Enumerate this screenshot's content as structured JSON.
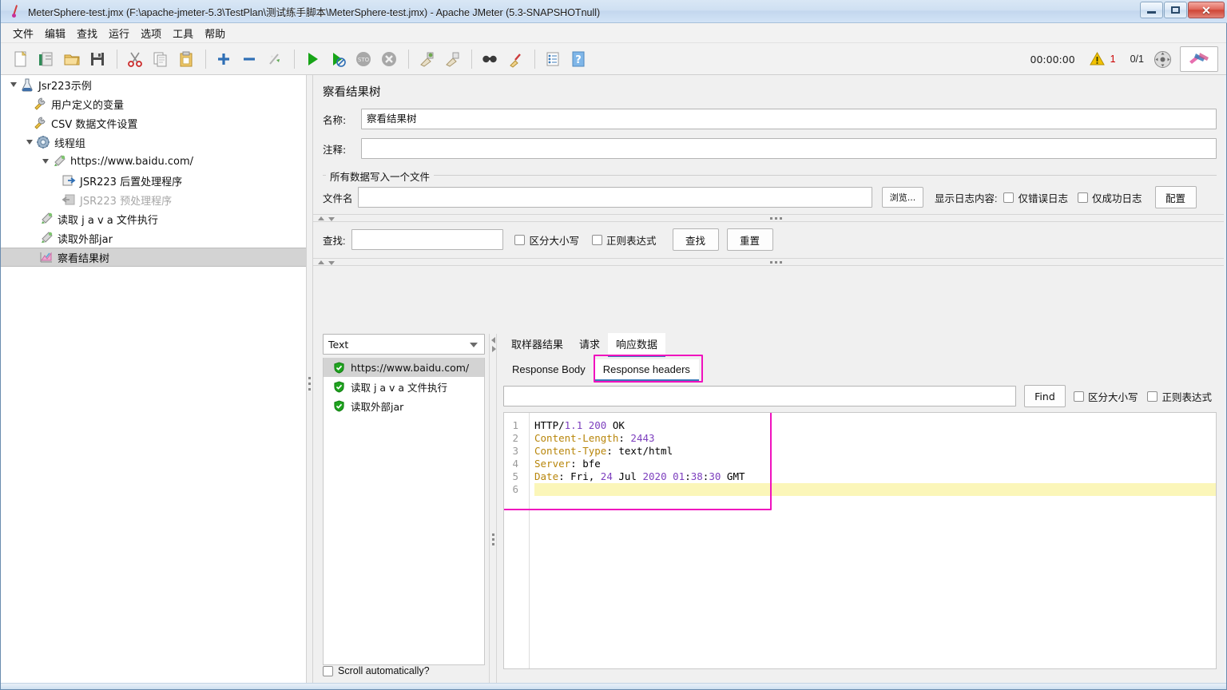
{
  "window": {
    "title": "MeterSphere-test.jmx (F:\\apache-jmeter-5.3\\TestPlan\\测试练手脚本\\MeterSphere-test.jmx) - Apache JMeter (5.3-SNAPSHOTnull)",
    "minimize_label": "–",
    "maximize_label": "❐",
    "close_label": "✕"
  },
  "menu": {
    "items": [
      {
        "label": "文件",
        "name": "menu-file"
      },
      {
        "label": "编辑",
        "name": "menu-edit"
      },
      {
        "label": "查找",
        "name": "menu-search"
      },
      {
        "label": "运行",
        "name": "menu-run"
      },
      {
        "label": "选项",
        "name": "menu-options"
      },
      {
        "label": "工具",
        "name": "menu-tools"
      },
      {
        "label": "帮助",
        "name": "menu-help"
      }
    ]
  },
  "toolbar": {
    "icons": [
      "new-icon",
      "templates-icon",
      "open-icon",
      "save-icon",
      "cut-icon",
      "copy-icon",
      "paste-icon",
      "expand-icon",
      "collapse-icon",
      "toggle-icon",
      "start-icon",
      "start-no-timers-icon",
      "stop-icon",
      "shutdown-icon",
      "clear-icon",
      "clear-all-icon",
      "search-icon",
      "search-reset-icon",
      "function-helper-icon",
      "help-icon"
    ],
    "elapsed_time": "00:00:00",
    "warning_count": "1",
    "thread_counts": "0/1",
    "logo_name": "jmeter-logo-button"
  },
  "tree": {
    "nodes": [
      {
        "label": "Jsr223示例",
        "icon": "test-plan-icon",
        "indent": 0,
        "expanded": true,
        "disabled": false,
        "selected": false
      },
      {
        "label": "用户定义的变量",
        "icon": "config-element-icon",
        "indent": 1,
        "expanded": null,
        "disabled": false,
        "selected": false
      },
      {
        "label": "CSV 数据文件设置",
        "icon": "config-element-icon",
        "indent": 1,
        "expanded": null,
        "disabled": false,
        "selected": false
      },
      {
        "label": "线程组",
        "icon": "thread-group-icon",
        "indent": 1,
        "expanded": true,
        "disabled": false,
        "selected": false
      },
      {
        "label": "https://www.baidu.com/",
        "icon": "http-sampler-icon",
        "indent": 2,
        "expanded": true,
        "disabled": false,
        "selected": false
      },
      {
        "label": "JSR223 后置处理程序",
        "icon": "post-processor-icon",
        "indent": 3,
        "expanded": null,
        "disabled": false,
        "selected": false
      },
      {
        "label": "JSR223 预处理程序",
        "icon": "pre-processor-icon",
        "indent": 3,
        "expanded": null,
        "disabled": true,
        "selected": false
      },
      {
        "label": "读取 j a v a 文件执行",
        "icon": "http-sampler-icon",
        "indent": 2,
        "expanded": null,
        "disabled": false,
        "selected": false
      },
      {
        "label": "读取外部jar",
        "icon": "http-sampler-icon",
        "indent": 2,
        "expanded": null,
        "disabled": false,
        "selected": false
      },
      {
        "label": "察看结果树",
        "icon": "view-results-tree-icon",
        "indent": 2,
        "expanded": null,
        "disabled": false,
        "selected": true
      }
    ]
  },
  "panel": {
    "title": "察看结果树",
    "name_label": "名称:",
    "name_value": "察看结果树",
    "comment_label": "注释:",
    "comment_value": "",
    "file_group_title": "所有数据写入一个文件",
    "filename_label": "文件名",
    "filename_value": "",
    "browse_button": "浏览...",
    "log_display_label": "显示日志内容:",
    "errors_only_label": "仅错误日志",
    "success_only_label": "仅成功日志",
    "configure_button": "配置"
  },
  "search": {
    "label": "查找:",
    "value": "",
    "case_sensitive_label": "区分大小写",
    "regex_label": "正则表达式",
    "find_button": "查找",
    "reset_button": "重置"
  },
  "results": {
    "render_selected": "Text",
    "items": [
      {
        "label": "https://www.baidu.com/",
        "status": "success",
        "selected": true
      },
      {
        "label": "读取 j a v a 文件执行",
        "status": "success",
        "selected": false
      },
      {
        "label": "读取外部jar",
        "status": "success",
        "selected": false
      }
    ],
    "scroll_automatically_label": "Scroll automatically?"
  },
  "tabs": {
    "main": [
      {
        "label": "取样器结果",
        "active": false
      },
      {
        "label": "请求",
        "active": false
      },
      {
        "label": "响应数据",
        "active": true
      }
    ],
    "sub": [
      {
        "label": "Response Body",
        "active": false
      },
      {
        "label": "Response headers",
        "active": true
      }
    ]
  },
  "response_search": {
    "value": "",
    "find_button": "Find",
    "case_sensitive_label": "区分大小写",
    "regex_label": "正则表达式"
  },
  "response_headers": {
    "lines": [
      {
        "no": "1",
        "text": "HTTP/1.1 200 OK",
        "highlight": false
      },
      {
        "no": "2",
        "text": "Content-Length: 2443",
        "highlight": false
      },
      {
        "no": "3",
        "text": "Content-Type: text/html",
        "highlight": false
      },
      {
        "no": "4",
        "text": "Server: bfe",
        "highlight": false
      },
      {
        "no": "5",
        "text": "Date: Fri, 24 Jul 2020 01:38:30 GMT",
        "highlight": false
      },
      {
        "no": "6",
        "text": "",
        "highlight": true
      }
    ]
  },
  "colors": {
    "annotation": "#f012be",
    "tab_underline": "#3a79b8",
    "highlight_line": "#fbf6b9",
    "warning": "#cc0000",
    "selection": "#d3d3d3"
  }
}
